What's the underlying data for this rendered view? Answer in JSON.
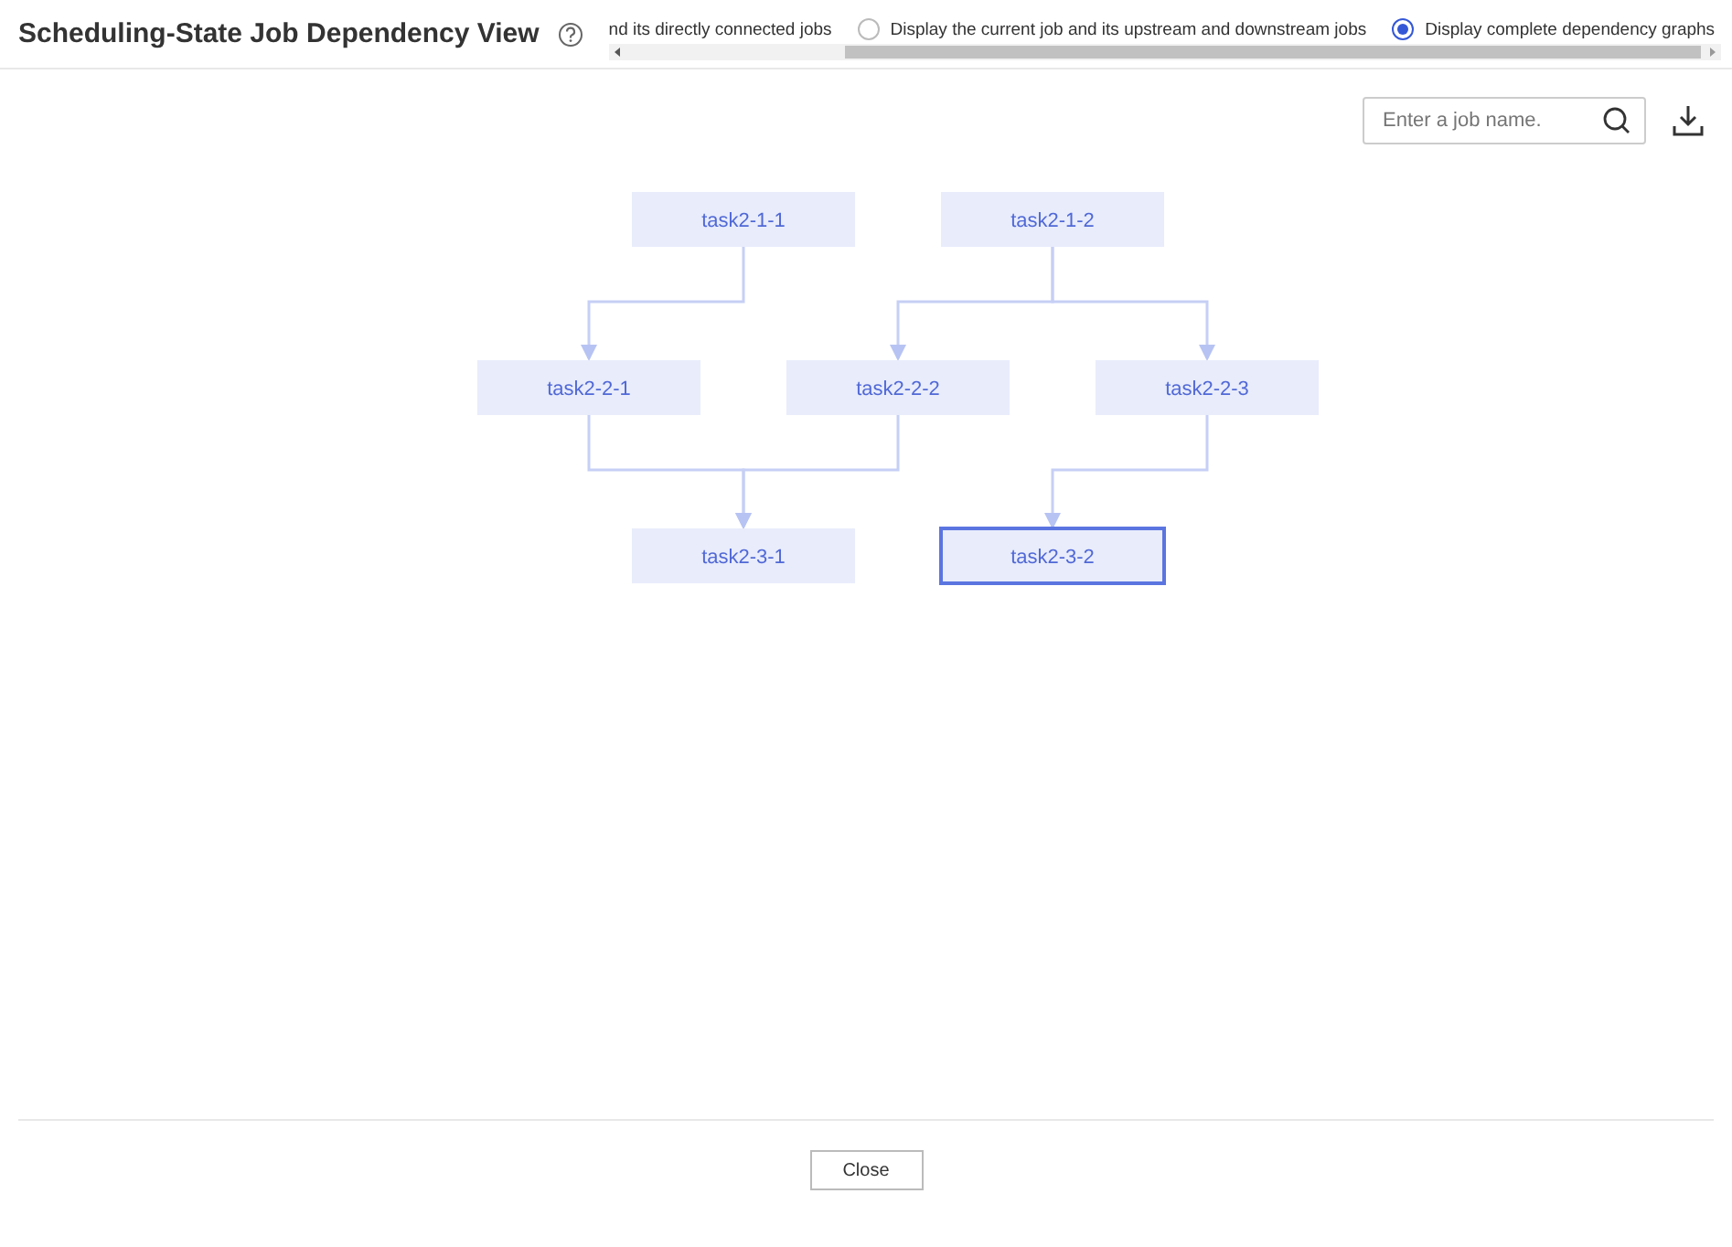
{
  "dialog": {
    "title": "Scheduling-State Job Dependency View"
  },
  "view_options": [
    {
      "label": "nd its directly connected jobs"
    },
    {
      "label": "Display the current job and its upstream and downstream jobs",
      "selected": false
    },
    {
      "label": "Display complete dependency graphs",
      "selected": true
    }
  ],
  "search": {
    "placeholder": "Enter a job name."
  },
  "graph": {
    "levels": [
      [
        {
          "label": "task2-1-1",
          "selected": false
        },
        {
          "label": "task2-1-2",
          "selected": false
        }
      ],
      [
        {
          "label": "task2-2-1",
          "selected": false
        },
        {
          "label": "task2-2-2",
          "selected": false
        },
        {
          "label": "task2-2-3",
          "selected": false
        }
      ],
      [
        {
          "label": "task2-3-1",
          "selected": false
        },
        {
          "label": "task2-3-2",
          "selected": true
        }
      ]
    ]
  },
  "buttons": [
    "Close"
  ]
}
